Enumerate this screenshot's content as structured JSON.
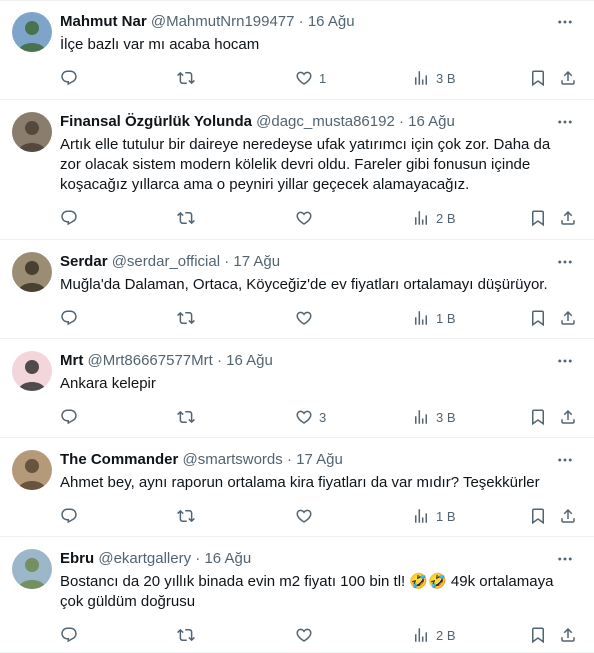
{
  "tweets": [
    {
      "name": "Mahmut Nar",
      "handle": "@MahmutNrn199477",
      "separator": "·",
      "time": "16 Ağu",
      "text": "İlçe bazlı var mı acaba hocam",
      "likes": "1",
      "views": "3 B",
      "avatar_colors": [
        "#7fa4c9",
        "#3f6b3a"
      ]
    },
    {
      "name": "Finansal Özgürlük Yolunda",
      "handle": "@dagc_musta86192",
      "separator": "·",
      "time": "16 Ağu",
      "text": "Artık elle tutulur bir daireye neredeyse ufak yatırımcı için çok zor. Daha da zor olacak sistem modern kölelik devri oldu. Fareler gibi fonusun içinde koşacağız yıllarca ama o peyniri yillar geçecek alamayacağız.",
      "likes": "",
      "views": "2 B",
      "avatar_colors": [
        "#8a7d6e",
        "#4b3f36"
      ]
    },
    {
      "name": "Serdar",
      "handle": "@serdar_official",
      "separator": "·",
      "time": "17 Ağu",
      "text": "Muğla'da Dalaman, Ortaca, Köyceğiz'de ev fiyatları ortalamayı düşürüyor.",
      "likes": "",
      "views": "1 B",
      "avatar_colors": [
        "#9a8d74",
        "#3a3226"
      ]
    },
    {
      "name": "Mrt",
      "handle": "@Mrt86667577Mrt",
      "separator": "·",
      "time": "16 Ağu",
      "text": "Ankara kelepir",
      "likes": "3",
      "views": "3 B",
      "avatar_colors": [
        "#f2d6dc",
        "#333333"
      ]
    },
    {
      "name": "The Commander",
      "handle": "@smartswords",
      "separator": "·",
      "time": "17 Ağu",
      "text": "Ahmet bey, aynı raporun ortalama kira fiyatları da var mıdır? Teşekkürler",
      "likes": "",
      "views": "1 B",
      "avatar_colors": [
        "#b49a78",
        "#5a4634"
      ]
    },
    {
      "name": "Ebru",
      "handle": "@ekartgallery",
      "separator": "·",
      "time": "16 Ağu",
      "text": "Bostancı da 20 yıllık binada evin m2 fiyatı 100 bin tl! 🤣🤣 49k ortalamaya çok güldüm doğrusu",
      "likes": "",
      "views": "2 B",
      "avatar_colors": [
        "#9bb7c9",
        "#6f8a4e"
      ]
    }
  ],
  "icons": {
    "reply": "reply-icon",
    "retweet": "retweet-icon",
    "like": "heart-icon",
    "views": "views-icon",
    "bookmark": "bookmark-icon",
    "share": "share-icon",
    "more": "more-icon"
  },
  "colors": {
    "text": "#0f1419",
    "secondary": "#536471",
    "divider": "#eff3f4"
  }
}
